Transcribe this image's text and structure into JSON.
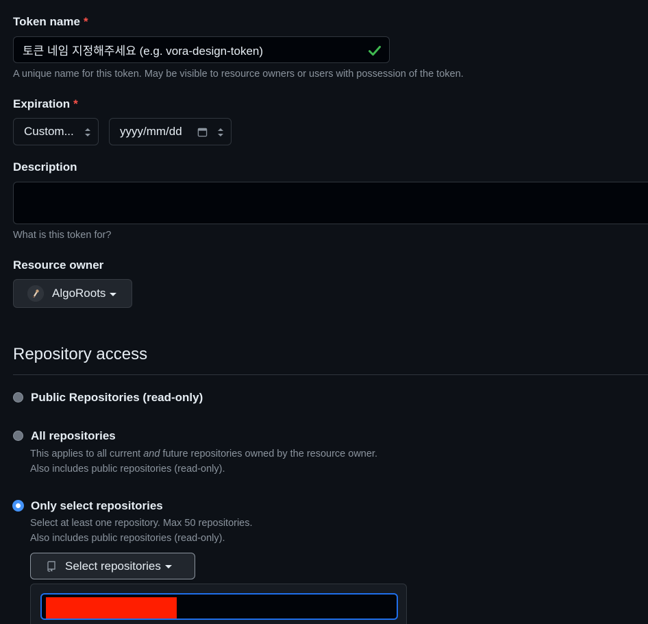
{
  "token_name": {
    "label": "Token name",
    "required_mark": "*",
    "value": "토큰 네임 지정해주세요 (e.g. vora-design-token)",
    "valid_icon": "check-icon",
    "help": "A unique name for this token. May be visible to resource owners or users with possession of the token."
  },
  "expiration": {
    "label": "Expiration",
    "required_mark": "*",
    "selected": "Custom...",
    "date_placeholder": "yyyy/mm/dd"
  },
  "description": {
    "label": "Description",
    "value": "",
    "help": "What is this token for?"
  },
  "resource_owner": {
    "label": "Resource owner",
    "selected": "AlgoRoots"
  },
  "repository_access": {
    "title": "Repository access",
    "options": [
      {
        "label": "Public Repositories (read-only)",
        "checked": false
      },
      {
        "label": "All repositories",
        "note_1_before": "This applies to all current ",
        "note_1_em": "and",
        "note_1_after": " future repositories owned by the resource owner.",
        "note_2": "Also includes public repositories (read-only).",
        "checked": false
      },
      {
        "label": "Only select repositories",
        "note_1": "Select at least one repository. Max 50 repositories.",
        "note_2": "Also includes public repositories (read-only).",
        "checked": true
      }
    ],
    "select_button": "Select repositories"
  },
  "colors": {
    "background": "#0d1117",
    "required": "#f85149",
    "valid": "#3fb950",
    "focus": "#1f6feb",
    "redaction": "#ff1e00"
  }
}
